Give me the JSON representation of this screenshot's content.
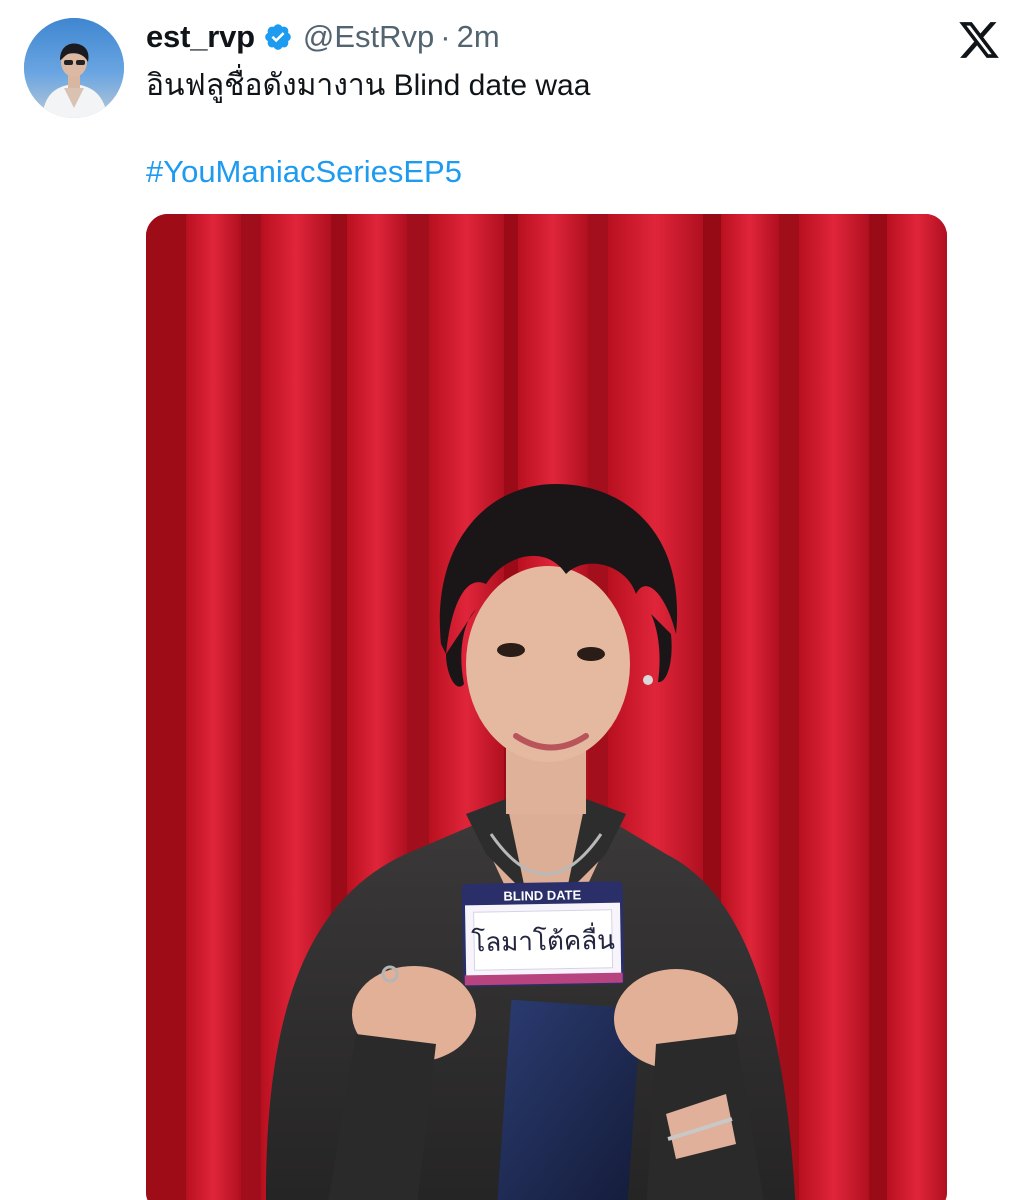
{
  "author": {
    "display_name": "est_rvp",
    "handle": "@EstRvp",
    "separator": "·",
    "timestamp": "2m",
    "verified": true,
    "verified_color": "#1d9bf0"
  },
  "post": {
    "text": "อินฟลูชื่อดังมางาน Blind date waa",
    "hashtag": "#YouManiacSeriesEP5",
    "hashtag_color": "#1d9bf0"
  },
  "media": {
    "card_header": "BLIND DATE",
    "card_name": "โลมาโต้คลื่น"
  },
  "icons": {
    "brand": "x-logo-icon",
    "verified": "verified-badge-icon"
  }
}
